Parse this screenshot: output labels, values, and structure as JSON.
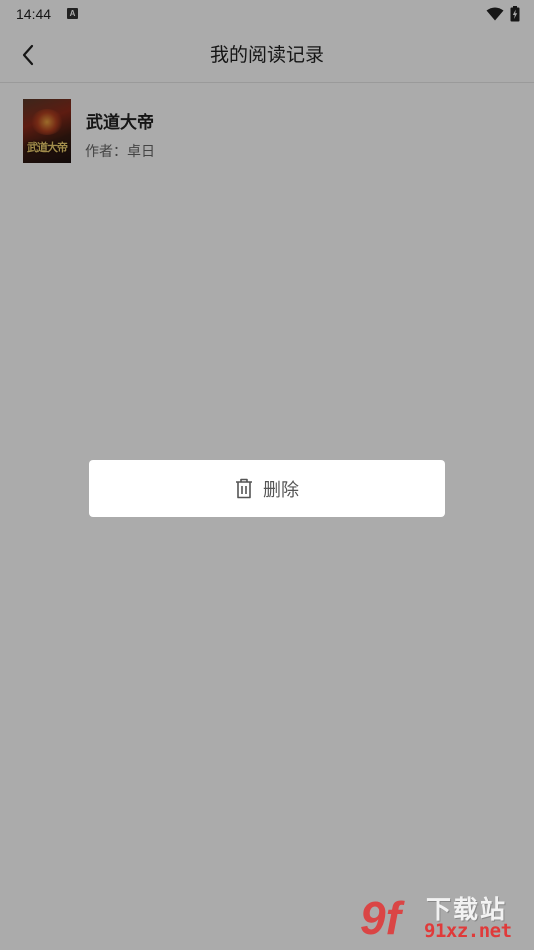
{
  "status_bar": {
    "time": "14:44",
    "notification_icon": "a-icon",
    "wifi_icon": "wifi-icon",
    "battery_icon": "battery-charging-icon"
  },
  "header": {
    "title": "我的阅读记录",
    "back_icon": "chevron-left-icon"
  },
  "records": [
    {
      "cover_text": "武道大帝",
      "title": "武道大帝",
      "author_label": "作者：",
      "author": "卓日"
    }
  ],
  "dialog": {
    "delete_icon": "trash-icon",
    "delete_label": "删除"
  },
  "watermark": {
    "logo": "9f",
    "text": "下载站",
    "url": "91xz.net"
  },
  "colors": {
    "scrim": "#000000",
    "watermark_red": "#e03a3a",
    "text_primary": "#222222",
    "text_secondary": "#666666"
  }
}
